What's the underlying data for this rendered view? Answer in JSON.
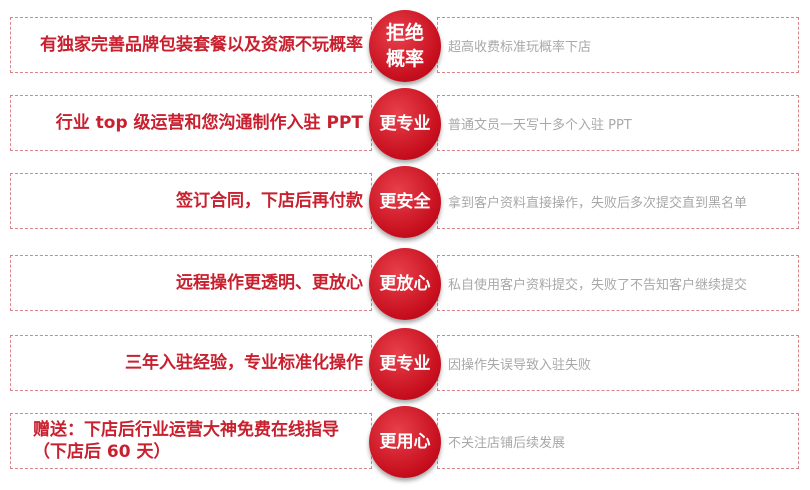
{
  "rows": [
    {
      "left_text": "有独家完善品牌包装套餐以及资源不玩概率",
      "badge_line1": "拒绝",
      "badge_line2": "概率",
      "right_text": "超高收费标准玩概率下店"
    },
    {
      "left_text": "行业 top 级运营和您沟通制作入驻 PPT",
      "badge": "更专业",
      "right_text": "普通文员一天写十多个入驻 PPT"
    },
    {
      "left_text": "签订合同，下店后再付款",
      "badge": "更安全",
      "right_text": "拿到客户资料直接操作，失败后多次提交直到黑名单"
    },
    {
      "left_text": "远程操作更透明、更放心",
      "badge": "更放心",
      "right_text": "私自使用客户资料提交，失败了不告知客户继续提交"
    },
    {
      "left_text": "三年入驻经验，专业标准化操作",
      "badge": "更专业",
      "right_text": "因操作失误导致入驻失败"
    },
    {
      "left_line1": "赠送：下店后行业运营大神免费在线指导",
      "left_line2": "（下店后 60 天）",
      "badge": "更用心",
      "right_text": "不关注店铺后续发展"
    }
  ]
}
